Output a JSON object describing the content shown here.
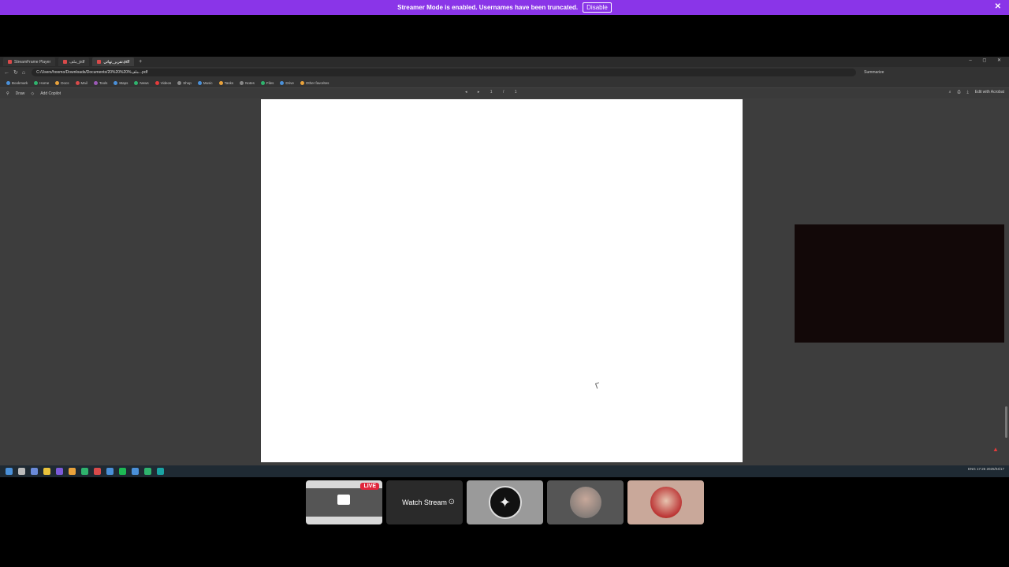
{
  "banner": {
    "text": "Streamer Mode is enabled. Usernames have been truncated.",
    "button": "Disable",
    "close": "✕"
  },
  "browser": {
    "tabs": [
      {
        "label": "StreamFrame Player"
      },
      {
        "label": "ملف_pdf"
      },
      {
        "label": "تقرير_نهائي.pdf"
      }
    ],
    "new_tab": "+",
    "window_controls": "– ◻ ✕",
    "url": "C:/Users/hoomo/Downloads/Documents/ملف%20%20%20...pdf",
    "url_extra": "Summarize",
    "bookmarks": [
      "Bookmark",
      "Home",
      "Docs",
      "Mail",
      "Tools",
      "Maps",
      "News",
      "Videos",
      "Shop",
      "Music",
      "Tasks",
      "Notes",
      "Files",
      "Drive",
      "Other favorites"
    ],
    "toolbar": {
      "draw": "Draw",
      "add_text": "Add Copilot",
      "edit": "Edit with Acrobat",
      "page_nav": "◂ ▸ 1 / 1"
    },
    "icon_colors": {
      "adobe": "#e53b3b"
    }
  },
  "taskbar": {
    "tray": "ENG 17:26 2025/04/17"
  },
  "participants": [
    {
      "id": "stream",
      "live": "LIVE"
    },
    {
      "id": "watch",
      "label": "Watch Stream"
    },
    {
      "id": "p3"
    },
    {
      "id": "p4"
    },
    {
      "id": "p5"
    }
  ]
}
